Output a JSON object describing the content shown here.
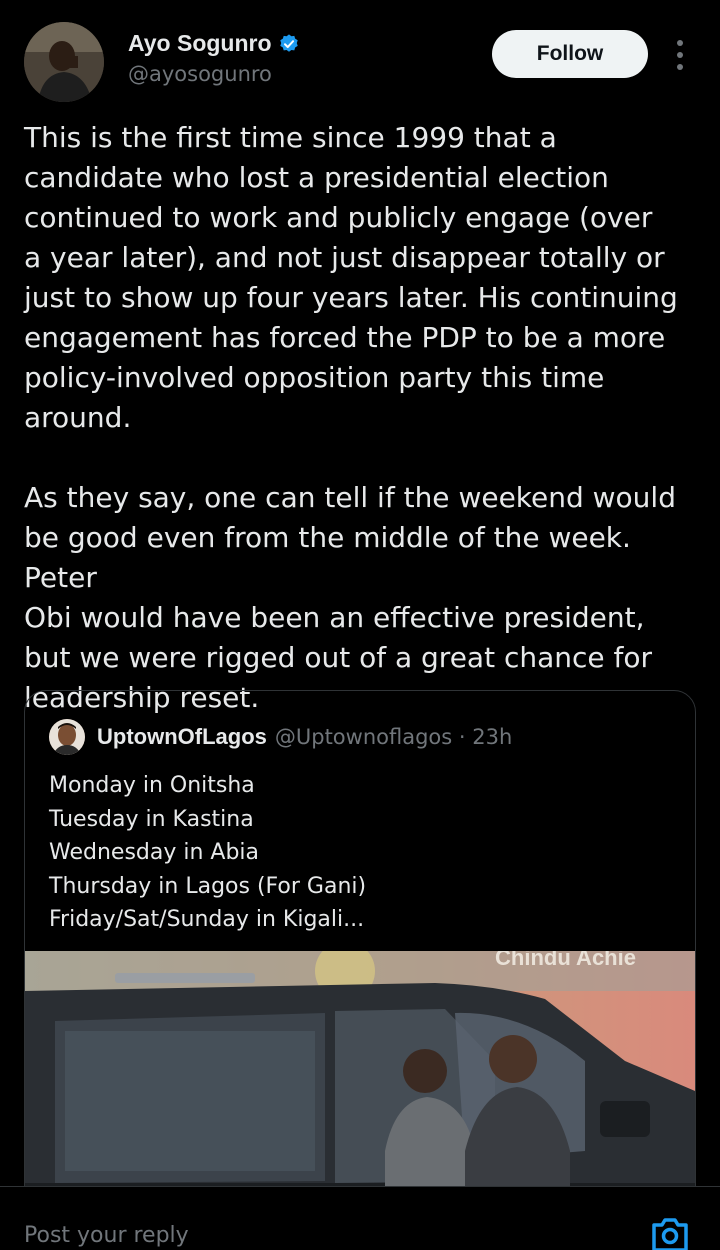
{
  "author": {
    "name": "Ayo Sogunro",
    "handle": "@ayosogunro",
    "follow_label": "Follow"
  },
  "tweet": {
    "text": "This is the first time since 1999 that a\ncandidate who lost a presidential election\ncontinued to work and publicly engage (over\na year later), and not just disappear totally or\njust to show up four years later. His continuing\nengagement has forced the PDP to be a more\npolicy-involved opposition party this time\naround.\n\nAs they say, one can tell if the weekend would\nbe good even from the middle of the week. Peter\nObi would have been an effective president,\nbut we were rigged out of a great chance for\nleadership reset."
  },
  "quote": {
    "name": "UptownOfLagos",
    "meta": "@Uptownoflagos · 23h",
    "text": "Monday in Onitsha\nTuesday in Kastina\nWednesday in Abia\nThursday in Lagos (For Gani)\nFriday/Sat/Sunday in Kigali..."
  },
  "reply": {
    "placeholder": "Post your reply"
  },
  "colors": {
    "background": "#000000",
    "text": "#e7e9ea",
    "muted": "#71767b",
    "verified": "#1d9bf0",
    "border": "#2f3336"
  },
  "icons": [
    "verified-badge-icon",
    "more-icon",
    "camera-icon"
  ]
}
